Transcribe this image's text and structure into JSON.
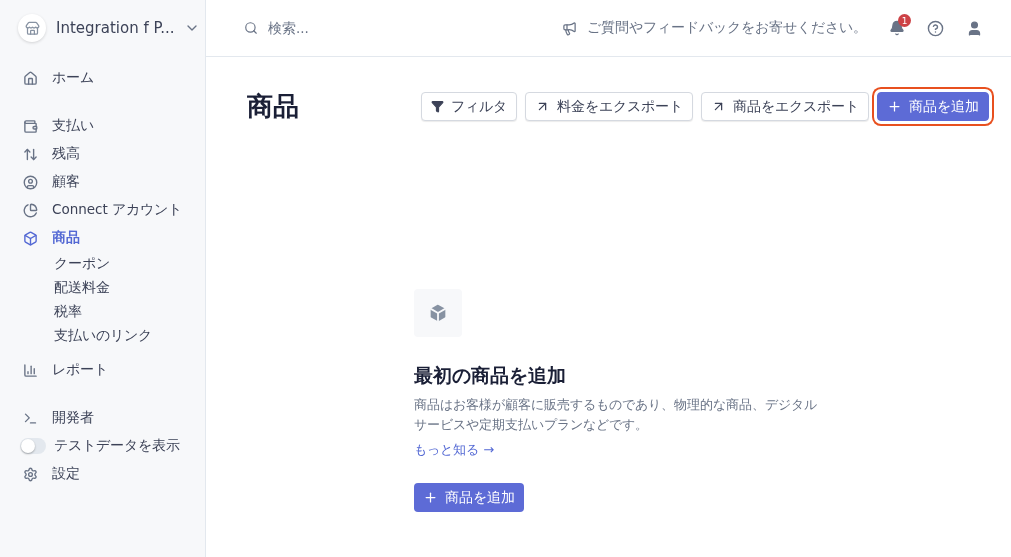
{
  "account": {
    "name": "Integration f P..."
  },
  "sidebar": {
    "groups": [
      [
        {
          "kind": "link",
          "label": "ホーム",
          "selected": false
        }
      ],
      [
        {
          "kind": "link",
          "label": "支払い",
          "selected": false
        },
        {
          "kind": "link",
          "label": "残高",
          "selected": false
        },
        {
          "kind": "link",
          "label": "顧客",
          "selected": false
        },
        {
          "kind": "link",
          "label": "Connect アカウント",
          "selected": false
        },
        {
          "kind": "link",
          "label": "商品",
          "selected": true,
          "children": [
            {
              "label": "クーポン"
            },
            {
              "label": "配送料金"
            },
            {
              "label": "税率"
            },
            {
              "label": "支払いのリンク"
            }
          ]
        },
        {
          "kind": "link",
          "label": "レポート",
          "selected": false
        }
      ],
      [
        {
          "kind": "link",
          "label": "開発者",
          "selected": false
        },
        {
          "kind": "toggle",
          "label": "テストデータを表示",
          "on": false
        },
        {
          "kind": "link",
          "label": "設定",
          "selected": false
        }
      ]
    ]
  },
  "header": {
    "search": {
      "placeholder": "検索..."
    },
    "feedback": "ご質問やフィードバックをお寄せください。",
    "notification_count": "1"
  },
  "page": {
    "title": "商品",
    "actions": [
      {
        "kind": "filter",
        "label": "フィルタ",
        "highlighted": false
      },
      {
        "kind": "export",
        "label": "料金をエクスポート",
        "highlighted": false
      },
      {
        "kind": "export",
        "label": "商品をエクスポート",
        "highlighted": false
      },
      {
        "kind": "primary",
        "label": "商品を追加",
        "highlighted": true
      }
    ]
  },
  "empty_state": {
    "title": "最初の商品を追加",
    "description": "商品はお客様が顧客に販売するものであり、物理的な商品、デジタルサービスや定期支払いプランなどです。",
    "link": "もっと知る →",
    "button": "商品を追加"
  }
}
